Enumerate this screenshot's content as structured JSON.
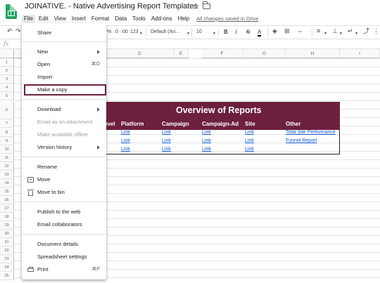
{
  "app": {
    "doc_title": "JOINATIVE. - Native Advertising Report Templates",
    "saved_status": "All changes saved in Drive"
  },
  "menubar": [
    "File",
    "Edit",
    "View",
    "Insert",
    "Format",
    "Data",
    "Tools",
    "Add-ons",
    "Help"
  ],
  "toolbar": {
    "percent": "%",
    "decrease_decimals": ".0",
    "increase_decimals": ".00",
    "number_format": "123",
    "font_family": "Default (Ari...",
    "font_size": "10",
    "bold": "B",
    "italic": "I",
    "strikethrough": "S",
    "text_color": "A"
  },
  "formula_bar": {
    "fx": "fx"
  },
  "columns": [
    "D",
    "E",
    "F",
    "G",
    "H",
    "I"
  ],
  "rows": [
    "1",
    "2",
    "3",
    "4",
    "5",
    "6",
    "7",
    "8",
    "9",
    "10",
    "11",
    "12",
    "13",
    "14",
    "15",
    "16",
    "17",
    "18",
    "19",
    "20",
    "21",
    "22",
    "23",
    "24",
    "25"
  ],
  "report": {
    "title": "Overview of Reports",
    "headers": [
      "evel",
      "Platform",
      "Campaign",
      "Campaign-Ad",
      "Site",
      "Other"
    ],
    "rows": [
      [
        "Link",
        "Link",
        "Link",
        "Link",
        "Total Site Performance"
      ],
      [
        "Link",
        "Link",
        "Link",
        "Link",
        "Funnel Report"
      ],
      [
        "Link",
        "Link",
        "Link",
        "Link",
        ""
      ]
    ]
  },
  "file_menu": {
    "share": "Share",
    "new": "New",
    "open": "Open",
    "open_shortcut": "⌘O",
    "import": "Import",
    "make_copy": "Make a copy",
    "download": "Download",
    "email_attachment": "Email as an attachment",
    "make_offline": "Make available offline",
    "version_history": "Version history",
    "rename": "Rename",
    "move": "Move",
    "move_to_bin": "Move to bin",
    "publish": "Publish to the web",
    "email_collaborators": "Email collaborators",
    "document_details": "Document details",
    "spreadsheet_settings": "Spreadsheet settings",
    "print": "Print",
    "print_shortcut": "⌘P"
  },
  "colors": {
    "report_header": "#6d1f3f",
    "link": "#1155cc",
    "sheets_green": "#1fa463"
  }
}
